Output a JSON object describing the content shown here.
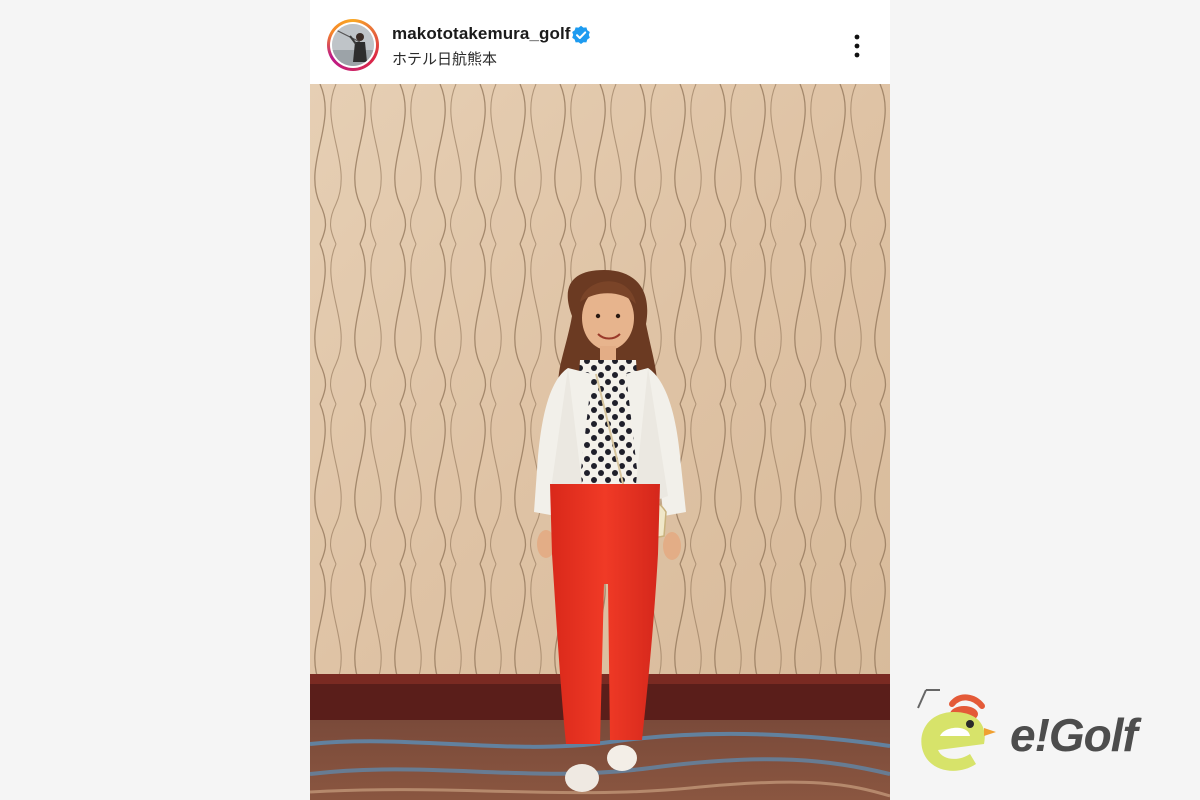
{
  "post": {
    "username": "makototakemura_golf",
    "location": "ホテル日航熊本",
    "verified": true,
    "more_icon": "more-vertical-icon"
  },
  "logo": {
    "text": "e!Golf",
    "icon": "mascot-bird-icon"
  },
  "colors": {
    "page_background": "#f5f5f5",
    "verified_blue": "#1d9bf0",
    "logo_green": "#d7e36a",
    "logo_text": "#4d4d4d"
  }
}
